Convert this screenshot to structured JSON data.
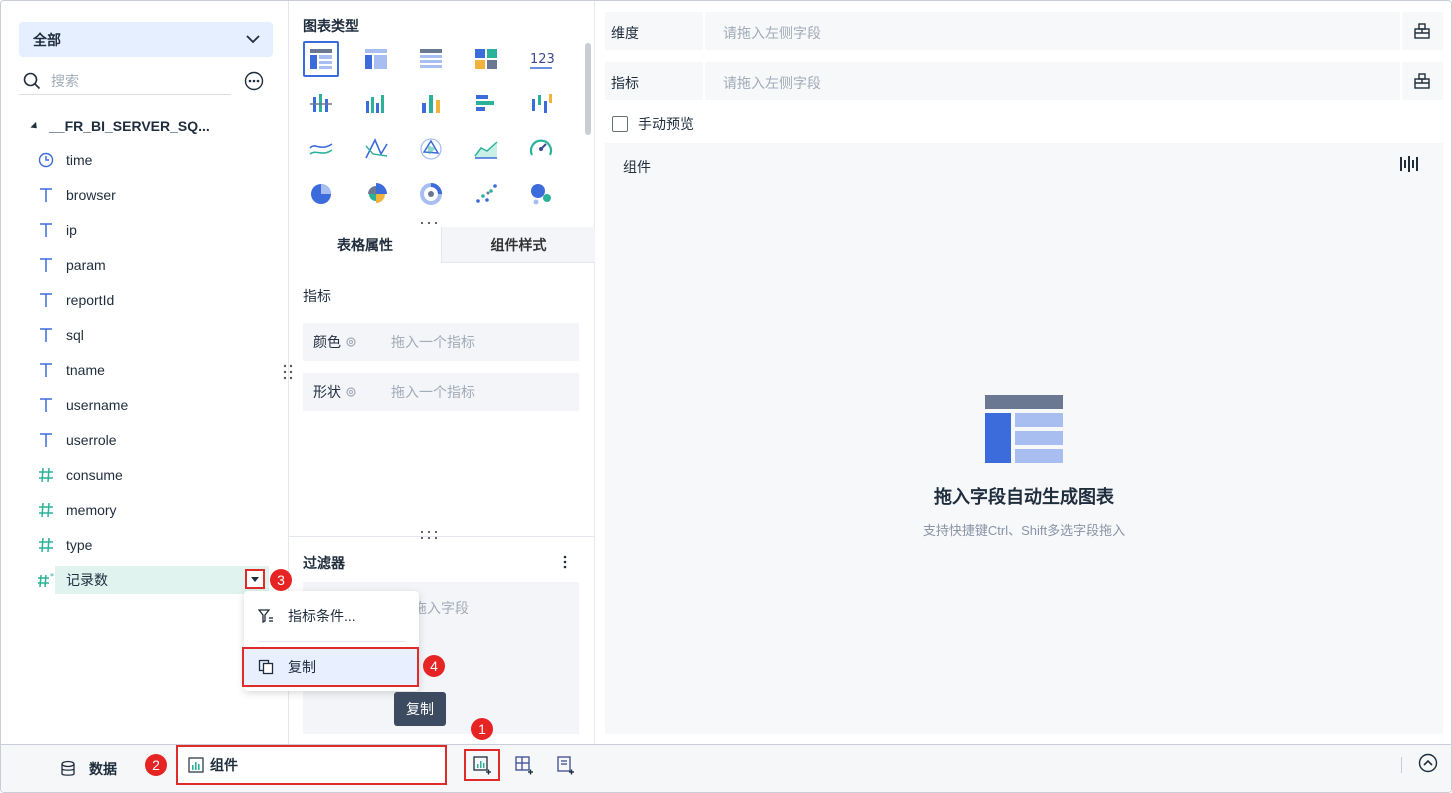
{
  "left": {
    "scope_label": "全部",
    "search_placeholder": "搜索",
    "table_name": "__FR_BI_SERVER_SQ...",
    "fields": [
      {
        "label": "time",
        "type": "date"
      },
      {
        "label": "browser",
        "type": "text"
      },
      {
        "label": "ip",
        "type": "text"
      },
      {
        "label": "param",
        "type": "text"
      },
      {
        "label": "reportId",
        "type": "text"
      },
      {
        "label": "sql",
        "type": "text"
      },
      {
        "label": "tname",
        "type": "text"
      },
      {
        "label": "username",
        "type": "text"
      },
      {
        "label": "userrole",
        "type": "text"
      },
      {
        "label": "consume",
        "type": "number"
      },
      {
        "label": "memory",
        "type": "number"
      },
      {
        "label": "type",
        "type": "number"
      },
      {
        "label": "记录数",
        "type": "number-calc"
      }
    ]
  },
  "context_menu": {
    "items": [
      {
        "label": "指标条件..."
      },
      {
        "label": "复制"
      }
    ],
    "tooltip": "复制"
  },
  "badges": [
    "1",
    "2",
    "3",
    "4"
  ],
  "middle": {
    "chart_types_title": "图表类型",
    "tabs": [
      {
        "label": "表格属性",
        "active": true
      },
      {
        "label": "组件样式",
        "active": false
      }
    ],
    "props_section": "指标",
    "props": [
      {
        "key": "颜色",
        "placeholder": "拖入一个指标"
      },
      {
        "key": "形状",
        "placeholder": "拖入一个指标"
      }
    ],
    "filter_title": "过滤器",
    "filter_placeholder": "拖入字段"
  },
  "right": {
    "dimension_label": "维度",
    "dimension_placeholder": "请拖入左侧字段",
    "measure_label": "指标",
    "measure_placeholder": "请拖入左侧字段",
    "manual_preview": "手动预览",
    "component_title": "组件",
    "empty_title": "拖入字段自动生成图表",
    "empty_subtitle": "支持快捷键Ctrl、Shift多选字段拖入"
  },
  "bottom": {
    "data_tab": "数据",
    "component_tab": "组件"
  },
  "colors": {
    "accent": "#3c6bdc",
    "highlight_red": "#e02b2b",
    "selected_field_bg": "#e1f3ef",
    "dimension_icon": "#3c6bdc",
    "measure_icon": "#2bb29a"
  }
}
